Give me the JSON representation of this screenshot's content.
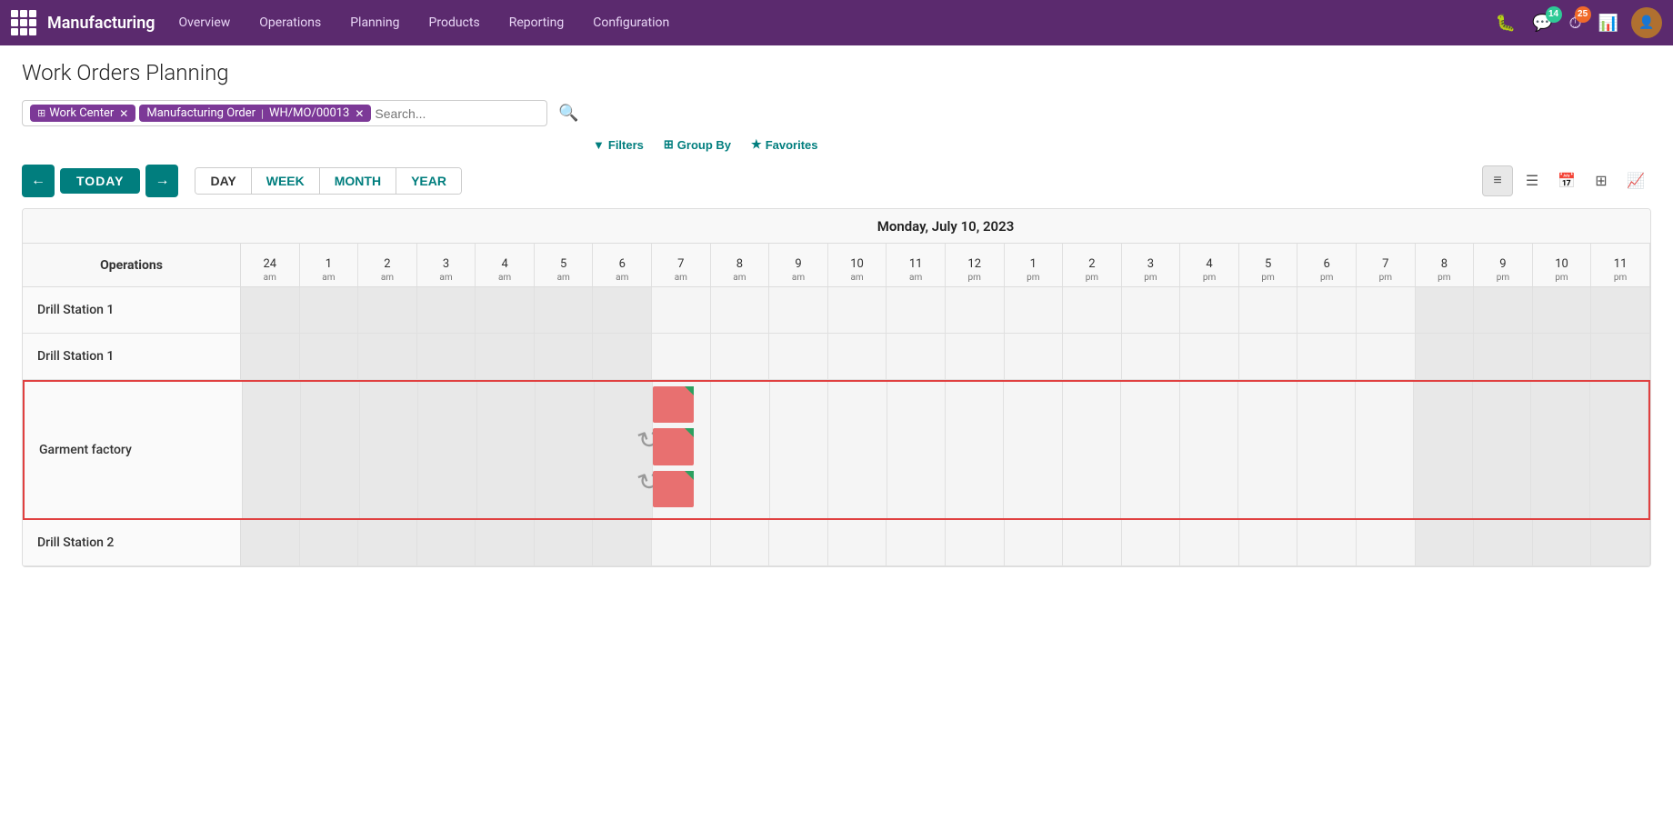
{
  "app": {
    "name": "Manufacturing"
  },
  "topnav": {
    "items": [
      {
        "label": "Overview",
        "id": "overview"
      },
      {
        "label": "Operations",
        "id": "operations"
      },
      {
        "label": "Planning",
        "id": "planning"
      },
      {
        "label": "Products",
        "id": "products"
      },
      {
        "label": "Reporting",
        "id": "reporting"
      },
      {
        "label": "Configuration",
        "id": "configuration"
      }
    ],
    "badges": {
      "bug": null,
      "chat": "14",
      "clock": "25"
    }
  },
  "page": {
    "title": "Work Orders Planning"
  },
  "search": {
    "tags": [
      {
        "icon": "layers",
        "label": "Work Center"
      },
      {
        "icon": "doc",
        "label": "Manufacturing Order",
        "value": "WH/MO/00013"
      }
    ],
    "placeholder": "Search..."
  },
  "toolbar": {
    "filters_label": "Filters",
    "group_by_label": "Group By",
    "favorites_label": "Favorites",
    "today_label": "TODAY",
    "periods": [
      {
        "label": "DAY",
        "active": true
      },
      {
        "label": "WEEK",
        "active": false
      },
      {
        "label": "MONTH",
        "active": false
      },
      {
        "label": "YEAR",
        "active": false
      }
    ]
  },
  "gantt": {
    "date_header": "Monday, July 10, 2023",
    "row_header": "Operations",
    "hours": [
      {
        "num": "24",
        "ampm": "am"
      },
      {
        "num": "1",
        "ampm": "am"
      },
      {
        "num": "2",
        "ampm": "am"
      },
      {
        "num": "3",
        "ampm": "am"
      },
      {
        "num": "4",
        "ampm": "am"
      },
      {
        "num": "5",
        "ampm": "am"
      },
      {
        "num": "6",
        "ampm": "am"
      },
      {
        "num": "7",
        "ampm": "am"
      },
      {
        "num": "8",
        "ampm": "am"
      },
      {
        "num": "9",
        "ampm": "am"
      },
      {
        "num": "10",
        "ampm": "am"
      },
      {
        "num": "11",
        "ampm": "am"
      },
      {
        "num": "12",
        "ampm": "pm"
      },
      {
        "num": "1",
        "ampm": "pm"
      },
      {
        "num": "2",
        "ampm": "pm"
      },
      {
        "num": "3",
        "ampm": "pm"
      },
      {
        "num": "4",
        "ampm": "pm"
      },
      {
        "num": "5",
        "ampm": "pm"
      },
      {
        "num": "6",
        "ampm": "pm"
      },
      {
        "num": "7",
        "ampm": "pm"
      },
      {
        "num": "8",
        "ampm": "pm"
      },
      {
        "num": "9",
        "ampm": "pm"
      },
      {
        "num": "10",
        "ampm": "pm"
      },
      {
        "num": "11",
        "ampm": "pm"
      }
    ],
    "rows": [
      {
        "label": "Drill Station 1",
        "highlighted": false,
        "tasks": []
      },
      {
        "label": "Drill Station 1",
        "highlighted": false,
        "tasks": []
      },
      {
        "label": "Garment factory",
        "highlighted": true,
        "tasks": [
          {
            "top": "5%",
            "left_col": 7,
            "width_cols": 1,
            "height": "28%"
          },
          {
            "top": "37%",
            "left_col": 7,
            "width_cols": 1,
            "height": "28%"
          },
          {
            "top": "68%",
            "left_col": 7,
            "width_cols": 1,
            "height": "28%"
          }
        ]
      },
      {
        "label": "Drill Station 2",
        "highlighted": false,
        "tasks": []
      }
    ]
  }
}
